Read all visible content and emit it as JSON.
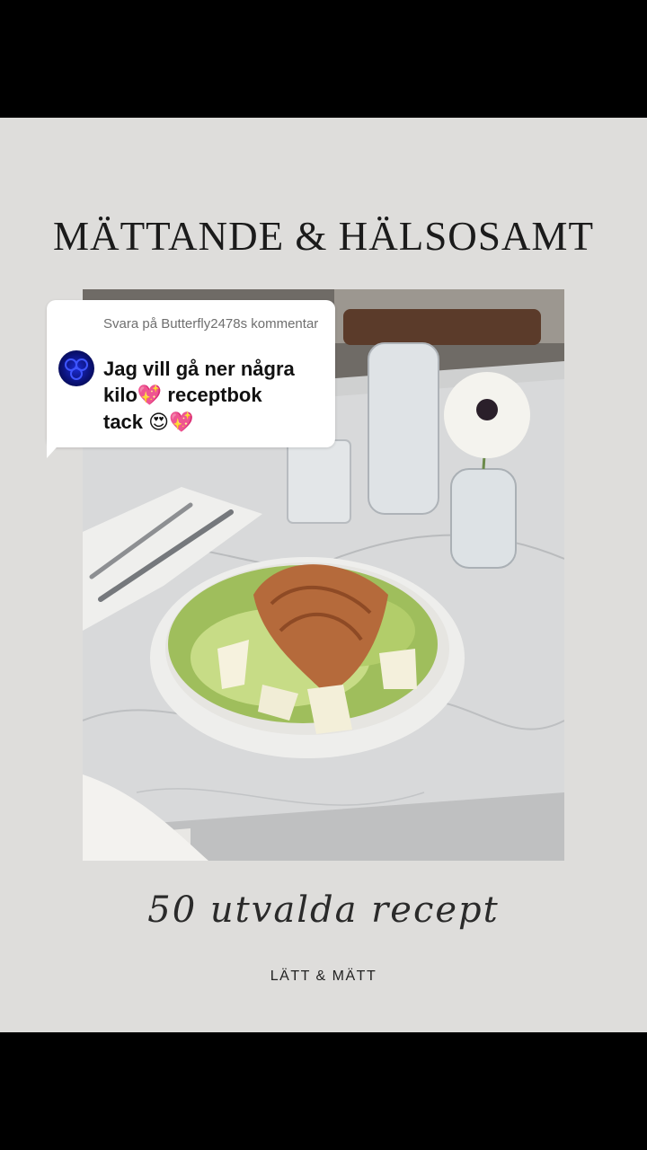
{
  "header": {
    "title": "MÄTTANDE & HÄLSOSAMT"
  },
  "reply": {
    "header": "Svara på Butterfly2478s kommentar",
    "comment_line1": "Jag vill gå ner några",
    "comment_line2a": "kilo",
    "comment_line2b": " receptbok",
    "comment_line3a": "tack ",
    "emoji_heart": "💖",
    "emoji_heart_eyes": "😍"
  },
  "footer": {
    "script_text": "50 utvalda recept",
    "subtitle": "LÄTT & MÄTT"
  }
}
